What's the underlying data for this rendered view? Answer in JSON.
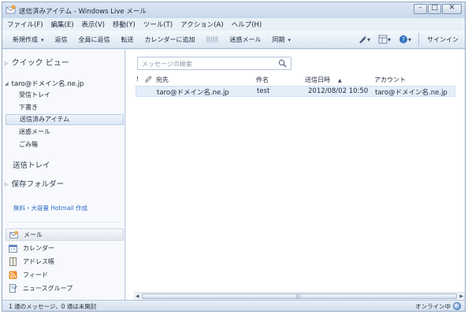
{
  "window": {
    "title": "送信済みアイテム - Windows Live メール",
    "buttons": {
      "minimize": "–",
      "maximize": "□",
      "close": "✕"
    }
  },
  "menubar": {
    "items": [
      "ファイル(F)",
      "編集(E)",
      "表示(V)",
      "移動(Y)",
      "ツール(T)",
      "アクション(A)",
      "ヘルプ(H)"
    ]
  },
  "toolbar": {
    "new_label": "新規作成",
    "send_label": "返信",
    "reply_all_label": "全員に返信",
    "forward_label": "転送",
    "add_calendar_label": "カレンダーに追加",
    "delete_label": "削除",
    "junk_label": "迷惑メール",
    "sync_label": "同期",
    "signin_label": "サインイン",
    "icons": [
      "pen-icon",
      "layout-icon",
      "help-icon"
    ]
  },
  "sidebar": {
    "quick_views": "クイック ビュー",
    "account": "taro@ドメイン名.ne.jp",
    "folders": [
      {
        "label": "受信トレイ",
        "selected": false
      },
      {
        "label": "下書き",
        "selected": false
      },
      {
        "label": "送信済みアイテム",
        "selected": true
      },
      {
        "label": "迷惑メール",
        "selected": false
      },
      {
        "label": "ごみ箱",
        "selected": false
      }
    ],
    "outbox": "送信トレイ",
    "storage_folders": "保存フォルダー",
    "hotmail_link": "無料・大容量 Hotmail 作成",
    "nav": [
      {
        "label": "メール",
        "icon": "mail-icon",
        "selected": true
      },
      {
        "label": "カレンダー",
        "icon": "calendar-icon",
        "selected": false
      },
      {
        "label": "アドレス帳",
        "icon": "address-book-icon",
        "selected": false
      },
      {
        "label": "フィード",
        "icon": "feed-icon",
        "selected": false
      },
      {
        "label": "ニュースグループ",
        "icon": "newsgroup-icon",
        "selected": false
      }
    ]
  },
  "message_list": {
    "search_placeholder": "メッセージの検索",
    "columns": {
      "flag": "!",
      "attach": "🖉",
      "to": "宛先",
      "subject": "件名",
      "date": "送信日時",
      "account": "アカウント"
    },
    "sort_column": "送信日時",
    "rows": [
      {
        "to": "taro@ドメイン名.ne.jp",
        "subject": "test",
        "date": "2012/08/02 10:50",
        "account": "taro@ドメイン名.ne.jp"
      }
    ]
  },
  "statusbar": {
    "left": "1 通のメッセージ、0 通は未開封",
    "right": "オンライン中"
  },
  "colors": {
    "accent": "#2b6bc6",
    "selection": "#e3eef9",
    "frame": "#dfe9f5"
  }
}
